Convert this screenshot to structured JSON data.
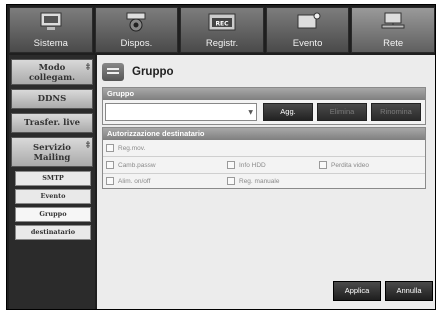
{
  "topbar": {
    "tabs": [
      {
        "label": "Sistema",
        "icon": "system-icon"
      },
      {
        "label": "Dispos.",
        "icon": "camera-icon"
      },
      {
        "label": "Registr.",
        "icon": "rec-icon"
      },
      {
        "label": "Evento",
        "icon": "event-icon"
      },
      {
        "label": "Rete",
        "icon": "network-icon"
      }
    ],
    "active_index": 4
  },
  "sidebar": {
    "items": [
      {
        "label_line1": "Modo",
        "label_line2": "collegam."
      },
      {
        "label_line1": "DDNS",
        "label_line2": ""
      },
      {
        "label_line1": "Trasfer. live",
        "label_line2": ""
      },
      {
        "label_line1": "Servizio",
        "label_line2": "Mailing"
      }
    ],
    "subitems": [
      "SMTP",
      "Evento",
      "Gruppo",
      "destinatario"
    ],
    "selected_sub": 2
  },
  "main": {
    "title": "Gruppo",
    "group_section": {
      "header": "Gruppo",
      "select_value": "",
      "buttons": {
        "add": "Agg.",
        "delete": "Elimina",
        "rename": "Rinomina"
      }
    },
    "auth_section": {
      "header": "Autorizzazione destinatario",
      "checkboxes": [
        "Reg.mov.",
        "Camb.passw",
        "Info HDD",
        "Perdita video",
        "Alim. on/off",
        "Reg. manuale"
      ]
    },
    "actions": {
      "apply": "Applica",
      "cancel": "Annulla"
    }
  },
  "colors": {
    "panel_bg": "#ececec",
    "frame_bg": "#1f1f1f",
    "section_header": "#8f8f8f"
  }
}
